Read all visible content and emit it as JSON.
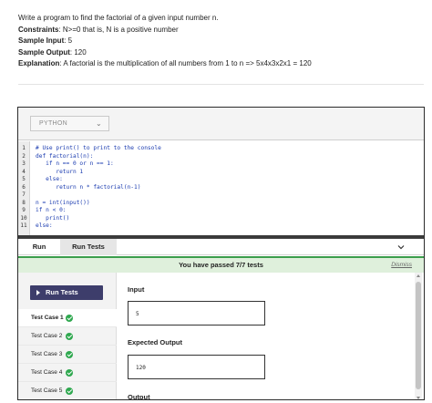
{
  "problem": {
    "statement": "Write a program to find the factorial of a given input number n.",
    "constraints_label": "Constraints",
    "constraints_value": ": N>=0 that is, N is a positive number",
    "sample_input_label": "Sample Input",
    "sample_input_value": ": 5",
    "sample_output_label": "Sample Output",
    "sample_output_value": ": 120",
    "explanation_label": "Explanation",
    "explanation_value": ": A factorial is the multiplication of all numbers from 1 to n => 5x4x3x2x1 = 120"
  },
  "toolbar": {
    "language": "PYTHON"
  },
  "editor": {
    "lines": [
      {
        "n": "1",
        "code": "# Use print() to print to the console"
      },
      {
        "n": "2",
        "code": "def factorial(n):"
      },
      {
        "n": "3",
        "code": "   if n == 0 or n == 1:"
      },
      {
        "n": "4",
        "code": "      return 1"
      },
      {
        "n": "5",
        "code": "   else:"
      },
      {
        "n": "6",
        "code": "      return n * factorial(n-1)"
      },
      {
        "n": "7",
        "code": ""
      },
      {
        "n": "8",
        "code": "n = int(input())"
      },
      {
        "n": "9",
        "code": "if n < 0:"
      },
      {
        "n": "10",
        "code": "   print()"
      },
      {
        "n": "11",
        "code": "else:"
      }
    ]
  },
  "tabs": {
    "run": "Run",
    "run_tests": "Run Tests"
  },
  "banner": {
    "message": "You have passed 7/7 tests",
    "dismiss": "Dismiss"
  },
  "results": {
    "run_tests_button": "Run Tests",
    "test_cases": [
      "Test Case 1",
      "Test Case 2",
      "Test Case 3",
      "Test Case 4",
      "Test Case 5"
    ],
    "input_label": "Input",
    "input_value": "5",
    "expected_output_label": "Expected Output",
    "expected_output_value": "120",
    "output_label": "Output"
  },
  "colors": {
    "banner_bg": "#dff0dc",
    "banner_border": "#3c9e4c",
    "run_button": "#3d3d6b",
    "check": "#2fa84f"
  }
}
